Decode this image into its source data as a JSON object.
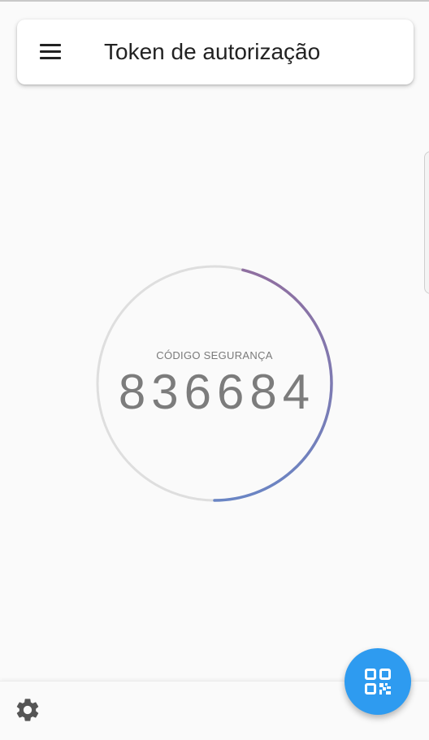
{
  "app_bar": {
    "title": "Token de autorização",
    "menu_icon": "menu-icon"
  },
  "token": {
    "label": "CÓDIGO SEGURANÇA",
    "code": "836684",
    "time_remaining_fraction": 0.5,
    "progress_colors": [
      "#8f6fa0",
      "#6a85c4"
    ],
    "track_color": "#dedede"
  },
  "bottom": {
    "settings_icon": "gear-icon"
  },
  "fab": {
    "icon": "qr-code-icon",
    "color": "#2e9bf0"
  }
}
